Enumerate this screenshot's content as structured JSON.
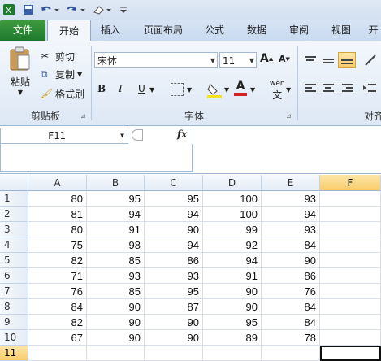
{
  "ribbon_tabs": [
    "文件",
    "开始",
    "插入",
    "页面布局",
    "公式",
    "数据",
    "审阅",
    "视图",
    "开"
  ],
  "clipboard": {
    "paste": "粘贴",
    "cut": "剪切",
    "copy": "复制",
    "format_painter": "格式刷",
    "group_label": "剪贴板"
  },
  "font": {
    "name": "宋体",
    "size": "11",
    "bold": "B",
    "italic": "I",
    "underline": "U",
    "wen": "wén",
    "font_color_letter": "A",
    "group_label": "字体"
  },
  "align": {
    "group_label": "对齐"
  },
  "formula_bar": {
    "name_box": "F11",
    "fx": "fx",
    "formula": ""
  },
  "sheet": {
    "columns": [
      "A",
      "B",
      "C",
      "D",
      "E",
      "F"
    ],
    "selected_column": "F",
    "rows": [
      {
        "n": "1",
        "cells": [
          "80",
          "95",
          "95",
          "100",
          "93",
          ""
        ]
      },
      {
        "n": "2",
        "cells": [
          "81",
          "94",
          "94",
          "100",
          "94",
          ""
        ]
      },
      {
        "n": "3",
        "cells": [
          "80",
          "91",
          "90",
          "99",
          "93",
          ""
        ]
      },
      {
        "n": "4",
        "cells": [
          "75",
          "98",
          "94",
          "92",
          "84",
          ""
        ]
      },
      {
        "n": "5",
        "cells": [
          "82",
          "85",
          "86",
          "94",
          "90",
          ""
        ]
      },
      {
        "n": "6",
        "cells": [
          "71",
          "93",
          "93",
          "91",
          "86",
          ""
        ]
      },
      {
        "n": "7",
        "cells": [
          "76",
          "85",
          "95",
          "90",
          "76",
          ""
        ]
      },
      {
        "n": "8",
        "cells": [
          "84",
          "90",
          "87",
          "90",
          "84",
          ""
        ]
      },
      {
        "n": "9",
        "cells": [
          "82",
          "90",
          "90",
          "95",
          "84",
          ""
        ]
      },
      {
        "n": "10",
        "cells": [
          "67",
          "90",
          "90",
          "89",
          "78",
          ""
        ]
      },
      {
        "n": "11",
        "cells": [
          "",
          "",
          "",
          "",
          "",
          ""
        ]
      }
    ],
    "selected_row": "11"
  },
  "colors": {
    "file_tab": "#2a8a36",
    "selection": "#f8cc6a",
    "accent_underline": "#d42020",
    "highlight": "#f5e31b"
  }
}
